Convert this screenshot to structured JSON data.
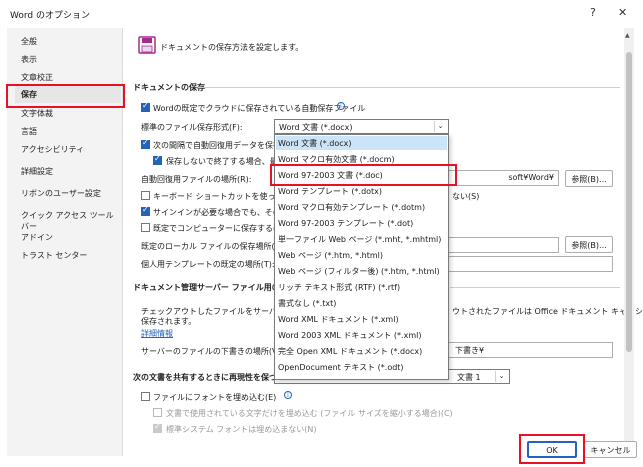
{
  "window": {
    "title": "Word のオプション",
    "help_label": "?",
    "close_label": "✕"
  },
  "sidebar": {
    "items": [
      "全般",
      "表示",
      "文章校正",
      "保存",
      "文字体裁",
      "言語",
      "アクセシビリティ",
      "詳細設定",
      "リボンのユーザー設定",
      "クイック アクセス ツール バー",
      "アドイン",
      "トラスト センター"
    ],
    "selected": "保存"
  },
  "header": {
    "text": "ドキュメントの保存方法を設定します。"
  },
  "save_docs": {
    "section": "ドキュメントの保存",
    "autosave_label": "Wordの既定でクラウドに保存されている自動保存ファイル",
    "format_label": "標準のファイル保存形式(F):",
    "format_value": "Word 文書 (*.docx)",
    "autorecover_label": "次の間隔で自動回復用データを保存す",
    "keep_last_label": "保存しないで終了する場合、最後",
    "autorecover_location_label": "自動回復用ファイルの場所(R):",
    "autorecover_location_value": "soft¥Word¥",
    "browse1": "参照(B)...",
    "keyboard_label": "キーボード ショートカットを使ってファイル",
    "keyboard_suffix": "ない(S)",
    "signin_label": "サインインが必要な場合でも、その他の",
    "save_to_computer_label": "既定でコンピューターに保存する(C)",
    "local_location_label": "既定のローカル ファイルの保存場所(I):",
    "browse2": "参照(B)...",
    "template_location_label": "個人用テンプレートの既定の場所(T):"
  },
  "server": {
    "section": "ドキュメント管理サーバー ファイル用のオフラ",
    "desc_line1a": "チェックアウトしたファイルをサーバーの [下書",
    "desc_line1b": "ウトされたファイルは Office ドキュメント キャッシュに",
    "desc_line2": "保存されます。",
    "details_link": "詳細情報",
    "drafts_label": "サーバーのファイルの下書きの場所(V):",
    "drafts_value": "下書き¥"
  },
  "fidelity": {
    "section": "次の文書を共有するときに再現性を保つ(D):",
    "doc_value": "文書 1",
    "embed_label": "ファイルにフォントを埋め込む(E)",
    "embed_used_label": "文書で使用されている文字だけを埋め込む (ファイル サイズを縮小する場合)(C)",
    "no_system_label": "標準システム フォントは埋め込まない(N)"
  },
  "dropdown": {
    "items": [
      "Word 文書 (*.docx)",
      "Word マクロ有効文書 (*.docm)",
      "Word 97-2003 文書 (*.doc)",
      "Word テンプレート (*.dotx)",
      "Word マクロ有効テンプレート (*.dotm)",
      "Word 97-2003 テンプレート (*.dot)",
      "単一ファイル Web ページ (*.mht, *.mhtml)",
      "Web ページ (*.htm, *.html)",
      "Web ページ (フィルター後) (*.htm, *.html)",
      "リッチ テキスト形式 (RTF) (*.rtf)",
      "書式なし (*.txt)",
      "Word XML ドキュメント (*.xml)",
      "Word 2003 XML ドキュメント (*.xml)",
      "完全 Open XML ドキュメント (*.docx)",
      "OpenDocument テキスト (*.odt)"
    ],
    "highlighted_index": 0,
    "outlined_index": 2
  },
  "footer": {
    "ok": "OK",
    "cancel": "キャンセル"
  },
  "colors": {
    "accent": "#2563b8",
    "highlight_box": "#e81123"
  }
}
